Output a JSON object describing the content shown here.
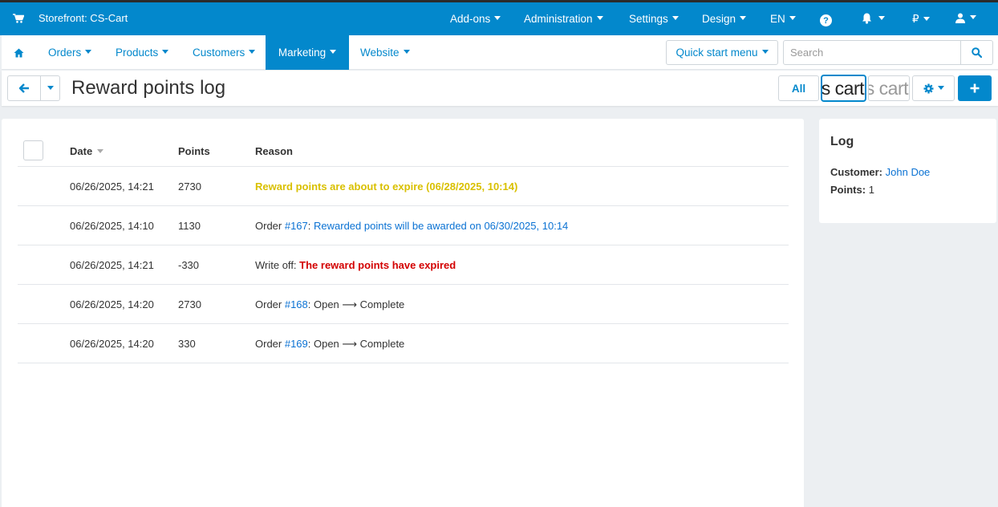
{
  "topbar": {
    "storefront": "Storefront: CS-Cart",
    "addons": "Add-ons",
    "administration": "Administration",
    "settings": "Settings",
    "design": "Design",
    "language": "EN",
    "currency": "₽"
  },
  "nav": {
    "items": [
      {
        "label": "Orders"
      },
      {
        "label": "Products"
      },
      {
        "label": "Customers"
      },
      {
        "label": "Marketing",
        "active": true
      },
      {
        "label": "Website"
      }
    ],
    "quick_start": "Quick start menu",
    "search_placeholder": "Search"
  },
  "titlebar": {
    "title": "Reward points log",
    "all_button": "All",
    "logo_text_active": "s cart",
    "logo_text_inactive": "s cart"
  },
  "table": {
    "headers": {
      "date": "Date",
      "points": "Points",
      "reason": "Reason"
    },
    "rows": [
      {
        "date": "06/26/2025, 14:21",
        "points": "2730",
        "reason_text": "Reward points are about to expire (06/28/2025, 10:14)"
      },
      {
        "date": "06/26/2025, 14:10",
        "points": "1130",
        "reason_prefix": "Order ",
        "order_link": "#167",
        "reason_link": "Rewarded points will be awarded on 06/30/2025, 10:14"
      },
      {
        "date": "06/26/2025, 14:21",
        "points": "-330",
        "reason_prefix": "Write off: ",
        "reason_text": "The reward points have expired"
      },
      {
        "date": "06/26/2025, 14:20",
        "points": "2730",
        "reason_prefix": "Order ",
        "order_link": "#168",
        "reason_suffix": ": Open ⟶ Complete"
      },
      {
        "date": "06/26/2025, 14:20",
        "points": "330",
        "reason_prefix": "Order ",
        "order_link": "#169",
        "reason_suffix": ": Open ⟶ Complete"
      }
    ]
  },
  "sidebar": {
    "title": "Log",
    "customer_label": "Customer:",
    "customer_name": "John Doe",
    "points_label": "Points:",
    "points_value": "1"
  },
  "colors": {
    "accent": "#0388cc",
    "link": "#0b72d3",
    "warning": "#d9c000",
    "danger": "#d30000"
  },
  "icons": [
    "cart-icon",
    "question-icon",
    "bell-icon",
    "user-icon",
    "home-icon",
    "search-icon",
    "arrow-left-icon",
    "gear-icon",
    "plus-icon"
  ]
}
